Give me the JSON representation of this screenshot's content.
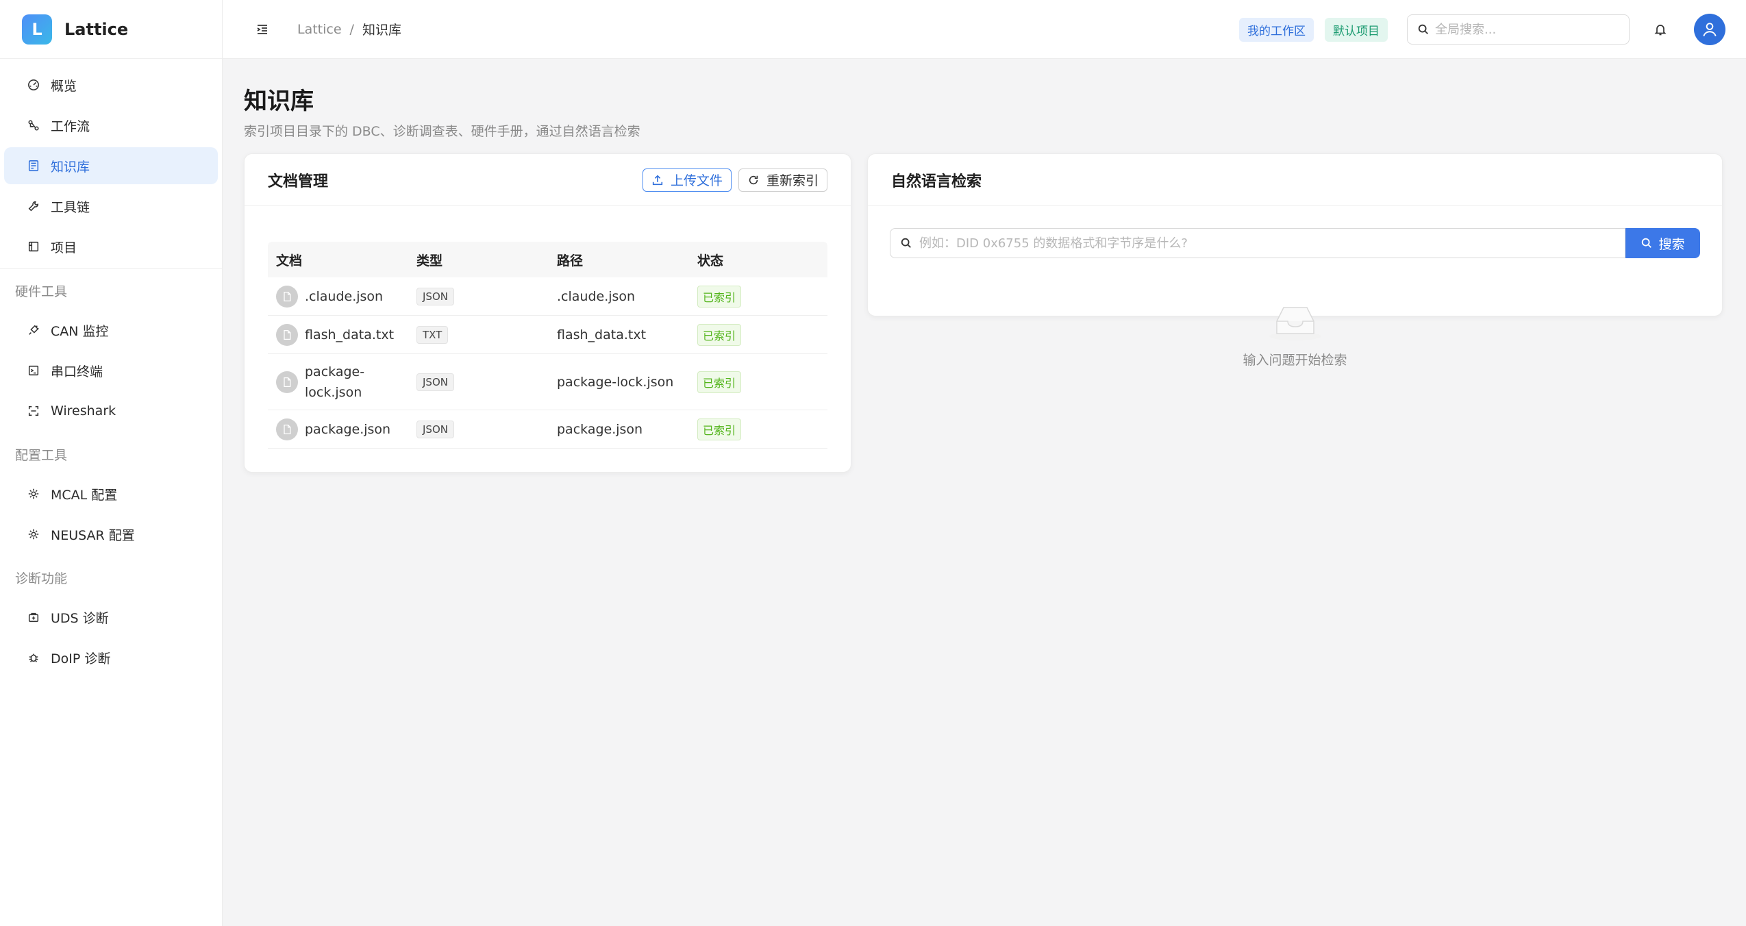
{
  "app": {
    "logo_letter": "L",
    "name": "Lattice"
  },
  "sidebar": {
    "items": [
      {
        "label": "概览",
        "icon": "dashboard-icon"
      },
      {
        "label": "工作流",
        "icon": "workflow-icon"
      },
      {
        "label": "知识库",
        "icon": "knowledge-icon",
        "active": true
      },
      {
        "label": "工具链",
        "icon": "wrench-icon"
      },
      {
        "label": "项目",
        "icon": "project-icon"
      }
    ],
    "sections": [
      {
        "title": "硬件工具",
        "items": [
          {
            "label": "CAN 监控",
            "icon": "plug-icon"
          },
          {
            "label": "串口终端",
            "icon": "terminal-icon"
          },
          {
            "label": "Wireshark",
            "icon": "scan-icon"
          }
        ]
      },
      {
        "title": "配置工具",
        "items": [
          {
            "label": "MCAL 配置",
            "icon": "gear-icon"
          },
          {
            "label": "NEUSAR 配置",
            "icon": "gear-icon"
          }
        ]
      },
      {
        "title": "诊断功能",
        "items": [
          {
            "label": "UDS 诊断",
            "icon": "medkit-icon"
          },
          {
            "label": "DoIP 诊断",
            "icon": "bug-icon"
          }
        ]
      }
    ]
  },
  "header": {
    "breadcrumb": [
      "Lattice",
      "知识库"
    ],
    "workspace_tag": "我的工作区",
    "project_tag": "默认项目",
    "search_placeholder": "全局搜索..."
  },
  "page": {
    "title": "知识库",
    "subtitle": "索引项目目录下的 DBC、诊断调查表、硬件手册，通过自然语言检索"
  },
  "doc_panel": {
    "title": "文档管理",
    "upload_label": "上传文件",
    "reindex_label": "重新索引",
    "columns": [
      "文档",
      "类型",
      "路径",
      "状态"
    ],
    "rows": [
      {
        "name": ".claude.json",
        "type": "JSON",
        "path": ".claude.json",
        "status": "已索引"
      },
      {
        "name": "flash_data.txt",
        "type": "TXT",
        "path": "flash_data.txt",
        "status": "已索引"
      },
      {
        "name": "package-lock.json",
        "type": "JSON",
        "path": "package-lock.json",
        "status": "已索引"
      },
      {
        "name": "package.json",
        "type": "JSON",
        "path": "package.json",
        "status": "已索引"
      }
    ]
  },
  "nl_panel": {
    "title": "自然语言检索",
    "placeholder": "例如：DID 0x6755 的数据格式和字节序是什么?",
    "search_label": "搜索",
    "empty_text": "输入问题开始检索"
  },
  "colors": {
    "accent": "#2f6fdb",
    "success": "#52b41a"
  }
}
